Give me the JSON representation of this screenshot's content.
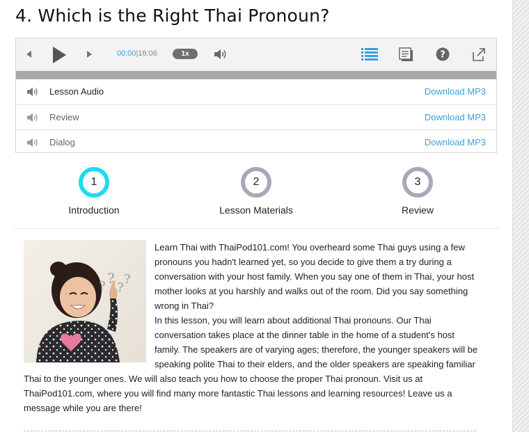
{
  "page": {
    "title": "4. Which is the Right Thai Pronoun?"
  },
  "player": {
    "current_time": "00:00",
    "separator": "|",
    "total_time": "16:06",
    "speed": "1x",
    "progress": 0,
    "icons": {
      "prev": "previous-icon",
      "play": "play-icon",
      "next": "next-icon",
      "volume": "volume-icon",
      "playlist": "playlist-icon",
      "notes": "notes-icon",
      "help": "help-icon",
      "popout": "popout-icon"
    },
    "accent_color": "#3aa0db",
    "tracks": [
      {
        "name": "Lesson Audio",
        "download": "Download MP3"
      },
      {
        "name": "Review",
        "download": "Download MP3"
      },
      {
        "name": "Dialog",
        "download": "Download MP3"
      }
    ]
  },
  "steps": [
    {
      "number": "1",
      "label": "Introduction",
      "active": true
    },
    {
      "number": "2",
      "label": "Lesson Materials",
      "active": false
    },
    {
      "number": "3",
      "label": "Review",
      "active": false
    }
  ],
  "step_active_color": "#1bdcf0",
  "step_inactive_color": "#a7a9b7",
  "lesson": {
    "image_icon": "lesson-photo",
    "paragraphs": [
      "Learn Thai with ThaiPod101.com! You overheard some Thai guys using a few pronouns you hadn't learned yet, so you decide to give them a try during a conversation with your host family. When you say one of them in Thai, your host mother looks at you harshly and walks out of the room. Did you say something wrong in Thai?",
      "In this lesson, you will learn about additional Thai pronouns. Our Thai conversation takes place at the dinner table in the home of a student's host family. The speakers are of varying ages; therefore, the younger speakers will be speaking polite Thai to their elders, and the older speakers are speaking familiar Thai to the younger ones. We will also teach you how to choose the proper Thai pronoun. Visit us at ThaiPod101.com, where you will find many more fantastic Thai lessons and learning resources! Leave us a message while you are there!"
    ]
  }
}
